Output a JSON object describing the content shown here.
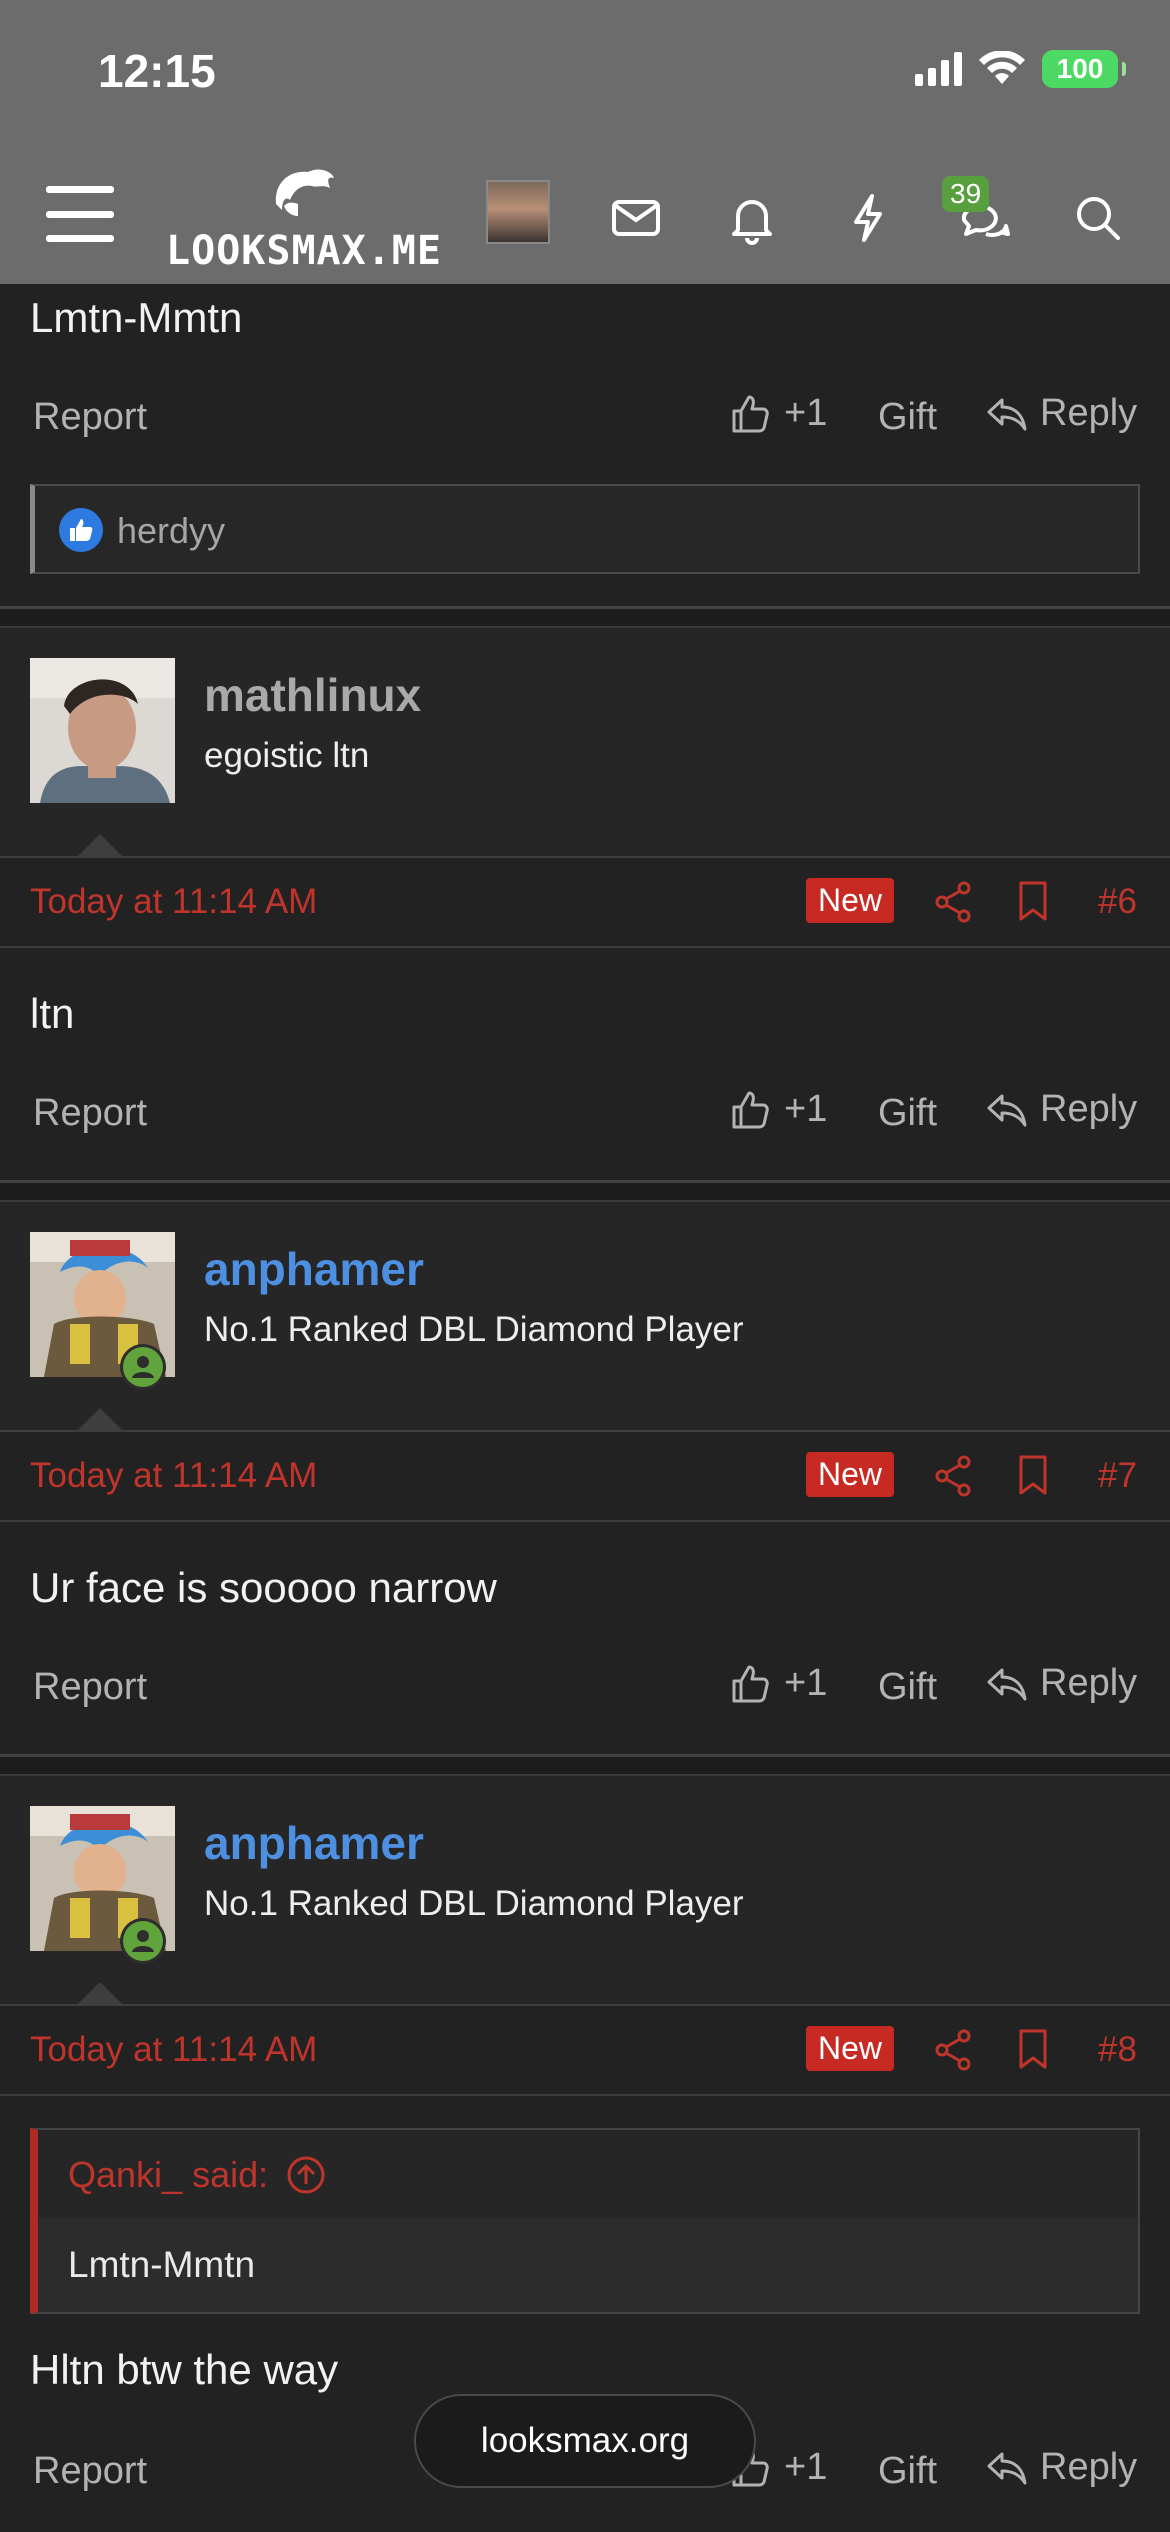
{
  "status_bar": {
    "time": "12:15",
    "battery": "100"
  },
  "header": {
    "logo_text": "LOOKSMAX.ME",
    "chat_badge": "39"
  },
  "top_post": {
    "text": "Lmtn-Mmtn",
    "actions": {
      "report": "Report",
      "like": "+1",
      "gift": "Gift",
      "reply": "Reply"
    },
    "reaction_user": "herdyy"
  },
  "posts": [
    {
      "username": "mathlinux",
      "user_title": "egoistic ltn",
      "name_color": "#a9a9a9",
      "time": "Today at 11:14 AM",
      "badge": "New",
      "number": "#6",
      "text": "ltn",
      "actions": {
        "report": "Report",
        "like": "+1",
        "gift": "Gift",
        "reply": "Reply"
      }
    },
    {
      "username": "anphamer",
      "user_title": "No.1 Ranked DBL Diamond Player",
      "name_color": "#4d8fe0",
      "time": "Today at 11:14 AM",
      "badge": "New",
      "number": "#7",
      "text": "Ur face is sooooo narrow",
      "actions": {
        "report": "Report",
        "like": "+1",
        "gift": "Gift",
        "reply": "Reply"
      }
    },
    {
      "username": "anphamer",
      "user_title": "No.1 Ranked DBL Diamond Player",
      "name_color": "#4d8fe0",
      "time": "Today at 11:14 AM",
      "badge": "New",
      "number": "#8",
      "quote_author": "Qanki_ said:",
      "quote_text": "Lmtn-Mmtn",
      "text": "Hltn btw the way",
      "actions": {
        "report": "Report",
        "like": "+1",
        "gift": "Gift",
        "reply": "Reply"
      }
    }
  ],
  "toast": "looksmax.org",
  "colors": {
    "accent_red": "#c0352b",
    "badge_red": "#c62a22",
    "online_green": "#61a43b",
    "reaction_blue": "#2d7ae0"
  }
}
